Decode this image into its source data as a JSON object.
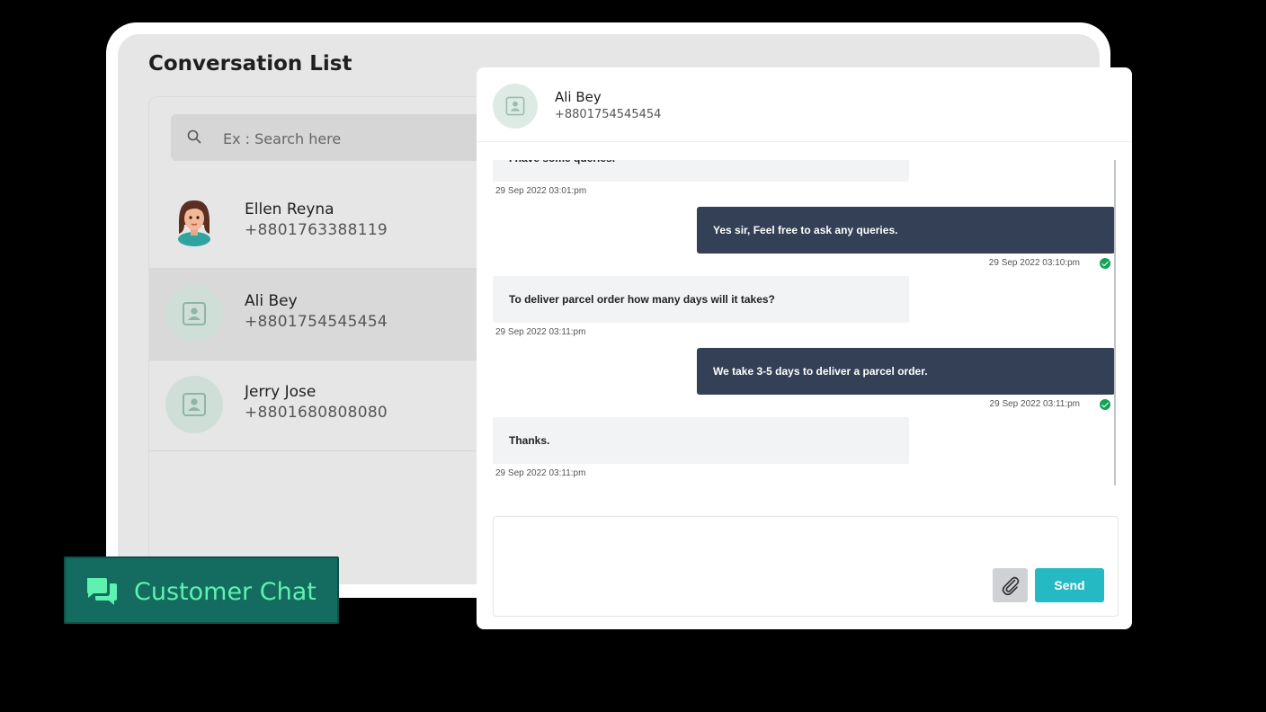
{
  "conversation_list": {
    "title": "Conversation List",
    "search_placeholder": "Ex : Search here",
    "contacts": [
      {
        "name": "Ellen Reyna",
        "phone": "+8801763388119",
        "avatar": "female-avatar"
      },
      {
        "name": "Ali Bey",
        "phone": "+8801754545454",
        "avatar": "contact-placeholder-icon",
        "active": true
      },
      {
        "name": "Jerry Jose",
        "phone": "+8801680808080",
        "avatar": "contact-placeholder-icon"
      }
    ]
  },
  "chat": {
    "contact_name": "Ali Bey",
    "contact_phone": "+8801754545454",
    "messages": [
      {
        "direction": "in",
        "text": "I have some queries.",
        "time": "29 Sep 2022 03:01:pm"
      },
      {
        "direction": "out",
        "text": "Yes sir, Feel free to ask any queries.",
        "time": "29 Sep 2022 03:10:pm",
        "read": true
      },
      {
        "direction": "in",
        "text": "To deliver parcel order how many days will it takes?",
        "time": "29 Sep 2022 03:11:pm"
      },
      {
        "direction": "out",
        "text": "We take 3-5 days to deliver a parcel order.",
        "time": "29 Sep 2022 03:11:pm",
        "read": true
      },
      {
        "direction": "in",
        "text": "Thanks.",
        "time": "29 Sep 2022 03:11:pm"
      }
    ],
    "composer": {
      "value": "",
      "send_label": "Send",
      "attach_icon": "paperclip-icon"
    }
  },
  "badge": {
    "label": "Customer Chat",
    "icon": "chat-bubbles-icon"
  },
  "colors": {
    "accent": "#25b9c4",
    "outgoing_bubble": "#334055",
    "badge_bg": "#146b5f",
    "badge_text": "#5ff1b0",
    "read_check": "#12a356"
  }
}
